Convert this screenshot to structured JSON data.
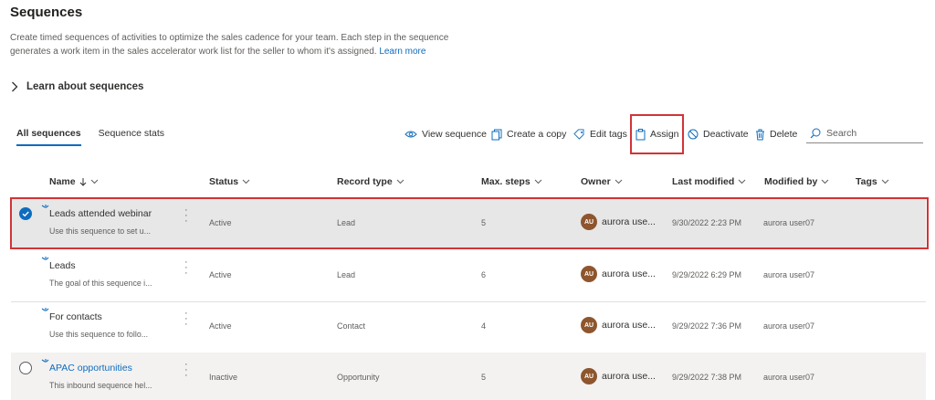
{
  "page": {
    "title": "Sequences",
    "description": "Create timed sequences of activities to optimize the sales cadence for your team. Each step in the sequence generates a work item in the sales accelerator work list for the seller to whom it's assigned.",
    "learn_more": "Learn more"
  },
  "learn_section": {
    "label": "Learn about sequences"
  },
  "tabs": [
    {
      "label": "All sequences",
      "active": true
    },
    {
      "label": "Sequence stats",
      "active": false
    }
  ],
  "toolbar": {
    "view": "View sequence",
    "copy": "Create a copy",
    "tags": "Edit tags",
    "assign": "Assign",
    "deactivate": "Deactivate",
    "delete": "Delete",
    "search_placeholder": "Search"
  },
  "columns": {
    "name": "Name",
    "status": "Status",
    "record_type": "Record type",
    "max_steps": "Max. steps",
    "owner": "Owner",
    "last_modified": "Last modified",
    "modified_by": "Modified by",
    "tags": "Tags"
  },
  "rows": [
    {
      "name": "Leads attended webinar",
      "desc": "Use this sequence to set u...",
      "status": "Active",
      "record_type": "Lead",
      "max_steps": "5",
      "owner_initials": "AU",
      "owner": "aurora use...",
      "last_modified": "9/30/2022 2:23 PM",
      "modified_by": "aurora user07",
      "selected": true,
      "link": false
    },
    {
      "name": "Leads",
      "desc": "The goal of this sequence i...",
      "status": "Active",
      "record_type": "Lead",
      "max_steps": "6",
      "owner_initials": "AU",
      "owner": "aurora use...",
      "last_modified": "9/29/2022 6:29 PM",
      "modified_by": "aurora user07",
      "selected": false,
      "link": false
    },
    {
      "name": "For contacts",
      "desc": "Use this sequence to follo...",
      "status": "Active",
      "record_type": "Contact",
      "max_steps": "4",
      "owner_initials": "AU",
      "owner": "aurora use...",
      "last_modified": "9/29/2022 7:36 PM",
      "modified_by": "aurora user07",
      "selected": false,
      "link": false
    },
    {
      "name": "APAC opportunities",
      "desc": "This inbound sequence hel...",
      "status": "Inactive",
      "record_type": "Opportunity",
      "max_steps": "5",
      "owner_initials": "AU",
      "owner": "aurora use...",
      "last_modified": "9/29/2022 7:38 PM",
      "modified_by": "aurora user07",
      "selected": false,
      "link": true
    }
  ],
  "colors": {
    "accent": "#0f6cbd",
    "highlight": "#d13438",
    "avatar": "#8e562e"
  }
}
